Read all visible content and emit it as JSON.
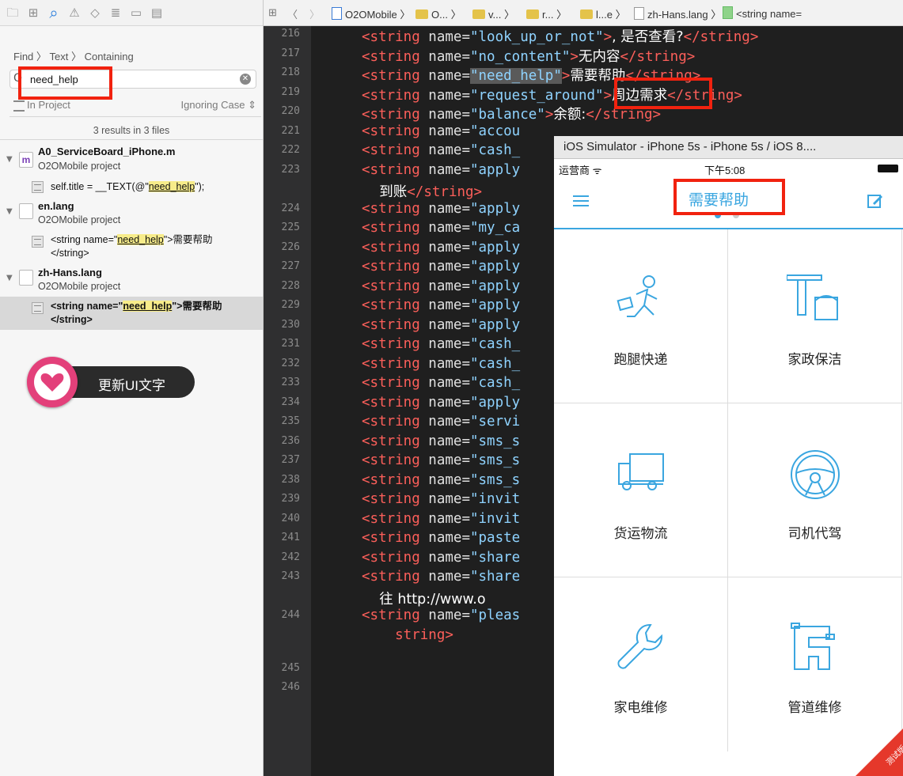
{
  "navigator": {
    "breadcrumb": "Find 〉 Text 〉 Containing",
    "search_value": "need_help",
    "scope": "In Project",
    "case_option": "Ignoring Case",
    "results_summary": "3 results in 3 files",
    "results": [
      {
        "file": "A0_ServiceBoard_iPhone.m",
        "project": "O2OMobile project",
        "match_pre": "self.title = __TEXT(@\"",
        "match_hl": "need_help",
        "match_post": "\");",
        "match_post2": ""
      },
      {
        "file": "en.lang",
        "project": "O2OMobile project",
        "match_pre": "<string name=\"",
        "match_hl": "need_help",
        "match_post": "\">需要帮助",
        "match_post2": "</string>"
      },
      {
        "file": "zh-Hans.lang",
        "project": "O2OMobile project",
        "match_pre": "<string name=\"",
        "match_hl": "need_help",
        "match_post": "\">需要帮助",
        "match_post2": "</string>"
      }
    ],
    "floating_button_label": "更新UI文字"
  },
  "jumpbar": {
    "items": [
      "O2OMobile",
      "O...",
      "v...",
      "r...",
      "l...e",
      "zh-Hans.lang",
      "<string name="
    ]
  },
  "editor": {
    "line_numbers": [
      "216",
      "217",
      "218",
      "219",
      "220",
      "221",
      "222",
      "223",
      "",
      "224",
      "225",
      "226",
      "227",
      "228",
      "229",
      "230",
      "231",
      "232",
      "233",
      "234",
      "235",
      "236",
      "237",
      "238",
      "239",
      "240",
      "241",
      "242",
      "243",
      "",
      "244",
      "",
      "245",
      "246"
    ],
    "lines": [
      {
        "ln": "216",
        "open": "<string",
        "attr": " name=",
        "val": "\"look_up_or_not\"",
        "rest": ">",
        "text": ", 是否查看?",
        "close": "</string>"
      },
      {
        "ln": "217",
        "open": "<string",
        "attr": " name=",
        "val": "\"no_content\"",
        "rest": ">",
        "text": "无内容",
        "close": "</string>"
      },
      {
        "ln": "218",
        "open": "<string",
        "attr": " name=",
        "val": "\"need_help\"",
        "rest": ">",
        "text": "需要帮助",
        "close": "</string>"
      },
      {
        "ln": "219",
        "open": "<string",
        "attr": " name=",
        "val": "\"request_around\"",
        "rest": ">",
        "text": "周边需求",
        "close": "</string>"
      },
      {
        "ln": "220",
        "open": "<string",
        "attr": " name=",
        "val": "\"balance\"",
        "rest": ">",
        "text": "余额:",
        "close": "</string>"
      },
      {
        "ln": "221",
        "open": "<string",
        "attr": " name=",
        "val": "\"accou",
        "rest": "",
        "text": "",
        "close": ""
      },
      {
        "ln": "222",
        "open": "<string",
        "attr": " name=",
        "val": "\"cash_",
        "rest": "",
        "text": "",
        "close": ""
      },
      {
        "ln": "223",
        "open": "<string",
        "attr": " name=",
        "val": "\"apply",
        "rest": "",
        "text": "",
        "close": ""
      },
      {
        "ln": "",
        "open": "",
        "attr": "",
        "val": "",
        "rest": "",
        "text": "    到账",
        "close": "</string>"
      },
      {
        "ln": "224",
        "open": "<string",
        "attr": " name=",
        "val": "\"apply",
        "rest": "",
        "text": "",
        "close": ""
      },
      {
        "ln": "225",
        "open": "<string",
        "attr": " name=",
        "val": "\"my_ca",
        "rest": "",
        "text": "",
        "close": ""
      },
      {
        "ln": "226",
        "open": "<string",
        "attr": " name=",
        "val": "\"apply",
        "rest": "",
        "text": "",
        "close": ""
      },
      {
        "ln": "227",
        "open": "<string",
        "attr": " name=",
        "val": "\"apply",
        "rest": "",
        "text": "",
        "close": ""
      },
      {
        "ln": "228",
        "open": "<string",
        "attr": " name=",
        "val": "\"apply",
        "rest": "",
        "text": "",
        "close": ""
      },
      {
        "ln": "229",
        "open": "<string",
        "attr": " name=",
        "val": "\"apply",
        "rest": "",
        "text": "",
        "close": ""
      },
      {
        "ln": "230",
        "open": "<string",
        "attr": " name=",
        "val": "\"apply",
        "rest": "",
        "text": "",
        "close": ""
      },
      {
        "ln": "231",
        "open": "<string",
        "attr": " name=",
        "val": "\"cash_",
        "rest": "",
        "text": "",
        "close": ""
      },
      {
        "ln": "232",
        "open": "<string",
        "attr": " name=",
        "val": "\"cash_",
        "rest": "",
        "text": "",
        "close": ""
      },
      {
        "ln": "233",
        "open": "<string",
        "attr": " name=",
        "val": "\"cash_",
        "rest": "",
        "text": "",
        "close": ""
      },
      {
        "ln": "234",
        "open": "<string",
        "attr": " name=",
        "val": "\"apply",
        "rest": "",
        "text": "",
        "close": ""
      },
      {
        "ln": "235",
        "open": "<string",
        "attr": " name=",
        "val": "\"servi",
        "rest": "",
        "text": "",
        "close": ""
      },
      {
        "ln": "236",
        "open": "<string",
        "attr": " name=",
        "val": "\"sms_s",
        "rest": "",
        "text": "",
        "close": ""
      },
      {
        "ln": "237",
        "open": "<string",
        "attr": " name=",
        "val": "\"sms_s",
        "rest": "",
        "text": "",
        "close": ""
      },
      {
        "ln": "238",
        "open": "<string",
        "attr": " name=",
        "val": "\"sms_s",
        "rest": "",
        "text": "",
        "close": ""
      },
      {
        "ln": "239",
        "open": "<string",
        "attr": " name=",
        "val": "\"invit",
        "rest": "",
        "text": "",
        "close": ""
      },
      {
        "ln": "240",
        "open": "<string",
        "attr": " name=",
        "val": "\"invit",
        "rest": "",
        "text": "",
        "close": ""
      },
      {
        "ln": "241",
        "open": "<string",
        "attr": " name=",
        "val": "\"paste",
        "rest": "",
        "text": "",
        "close": ""
      },
      {
        "ln": "242",
        "open": "<string",
        "attr": " name=",
        "val": "\"share",
        "rest": "",
        "text": "",
        "close": ""
      },
      {
        "ln": "243",
        "open": "<string",
        "attr": " name=",
        "val": "\"share",
        "rest": "",
        "text": "",
        "close": ""
      },
      {
        "ln": "",
        "open": "",
        "attr": "",
        "val": "",
        "rest": "",
        "text": "    往 http://www.o",
        "close": ""
      },
      {
        "ln": "244",
        "open": "<string",
        "attr": " name=",
        "val": "\"pleas",
        "rest": "",
        "text": "",
        "close": ""
      },
      {
        "ln": "",
        "open": "",
        "attr": "",
        "val": "",
        "rest": "",
        "text": "",
        "close": "    string>"
      }
    ]
  },
  "simulator": {
    "window_title": "iOS Simulator - iPhone 5s - iPhone 5s / iOS 8....",
    "carrier": "运营商",
    "time": "下午5:08",
    "nav_title": "需要帮助",
    "services": [
      "跑腿快递",
      "家政保洁",
      "货运物流",
      "司机代驾",
      "家电维修",
      "管道维修"
    ],
    "corner_badge": "测试版",
    "accent_color": "#3aa6e0"
  }
}
